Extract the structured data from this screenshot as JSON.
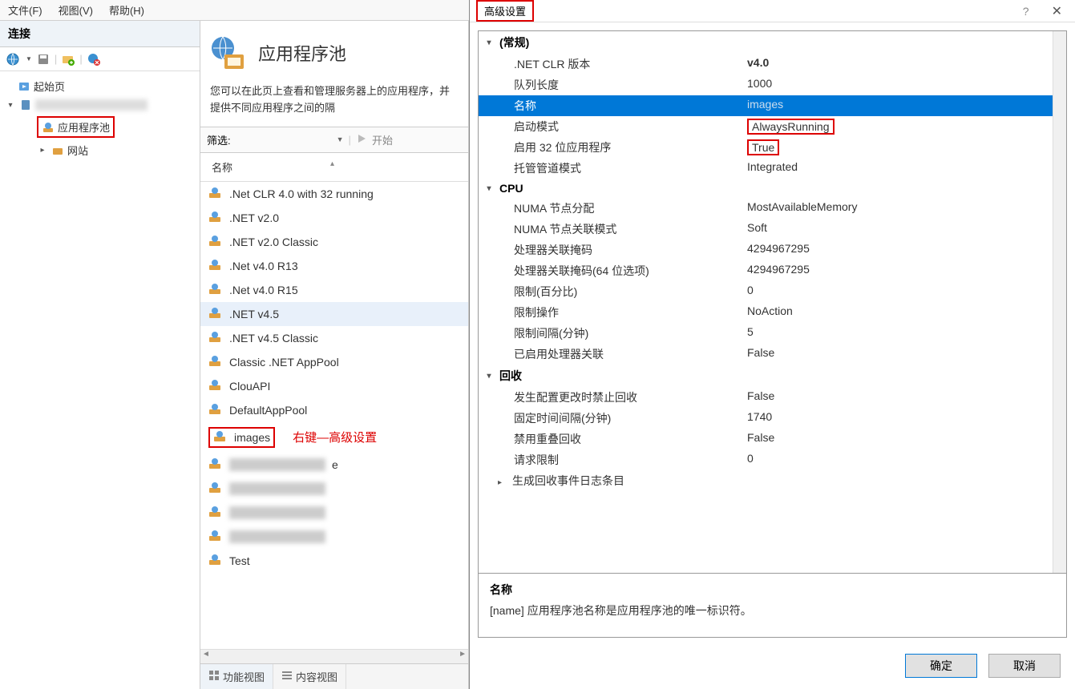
{
  "menubar": {
    "file": "文件(F)",
    "view": "视图(V)",
    "help": "帮助(H)"
  },
  "left": {
    "header": "连接",
    "tree": {
      "start_page": "起始页",
      "app_pools": "应用程序池",
      "sites": "网站"
    }
  },
  "center": {
    "title": "应用程序池",
    "desc": "您可以在此页上查看和管理服务器上的应用程序，并提供不同应用程序之间的隔",
    "filter_label": "筛选:",
    "start_label": "开始",
    "col_name": "名称",
    "pools": [
      ".Net CLR 4.0 with 32 running",
      ".NET v2.0",
      ".NET v2.0 Classic",
      ".Net v4.0 R13",
      ".Net v4.0 R15",
      ".NET v4.5",
      ".NET v4.5 Classic",
      "Classic .NET AppPool",
      "ClouAPI",
      "DefaultAppPool",
      "images",
      "",
      "",
      "",
      "",
      "Test"
    ],
    "blurred_suffix_11": "e",
    "annotation": "右键—高级设置",
    "tab_feature": "功能视图",
    "tab_content": "内容视图"
  },
  "dialog": {
    "title": "高级设置",
    "help": "?",
    "close": "✕",
    "groups": {
      "general": "(常规)",
      "cpu": "CPU",
      "recycle": "回收"
    },
    "rows": {
      "net_clr": {
        "label": ".NET CLR 版本",
        "value": "v4.0"
      },
      "queue_len": {
        "label": "队列长度",
        "value": "1000"
      },
      "name": {
        "label": "名称",
        "value": "images"
      },
      "start_mode": {
        "label": "启动模式",
        "value": "AlwaysRunning"
      },
      "enable32": {
        "label": "启用 32 位应用程序",
        "value": "True"
      },
      "pipeline": {
        "label": "托管管道模式",
        "value": "Integrated"
      },
      "numa_alloc": {
        "label": "NUMA 节点分配",
        "value": "MostAvailableMemory"
      },
      "numa_affinity": {
        "label": "NUMA 节点关联模式",
        "value": "Soft"
      },
      "affinity_mask": {
        "label": "处理器关联掩码",
        "value": "4294967295"
      },
      "affinity_mask64": {
        "label": "处理器关联掩码(64 位选项)",
        "value": "4294967295"
      },
      "limit_pct": {
        "label": "限制(百分比)",
        "value": "0"
      },
      "limit_action": {
        "label": "限制操作",
        "value": "NoAction"
      },
      "limit_interval": {
        "label": "限制间隔(分钟)",
        "value": "5"
      },
      "affinity_enabled": {
        "label": "已启用处理器关联",
        "value": "False"
      },
      "recycle_cfg": {
        "label": "发生配置更改时禁止回收",
        "value": "False"
      },
      "recycle_time": {
        "label": "固定时间间隔(分钟)",
        "value": "1740"
      },
      "recycle_overlap": {
        "label": "禁用重叠回收",
        "value": "False"
      },
      "recycle_requests": {
        "label": "请求限制",
        "value": "0"
      },
      "recycle_events": {
        "label": "生成回收事件日志条目",
        "value": ""
      }
    },
    "desc": {
      "title": "名称",
      "text": "[name] 应用程序池名称是应用程序池的唯一标识符。"
    },
    "buttons": {
      "ok": "确定",
      "cancel": "取消"
    }
  }
}
